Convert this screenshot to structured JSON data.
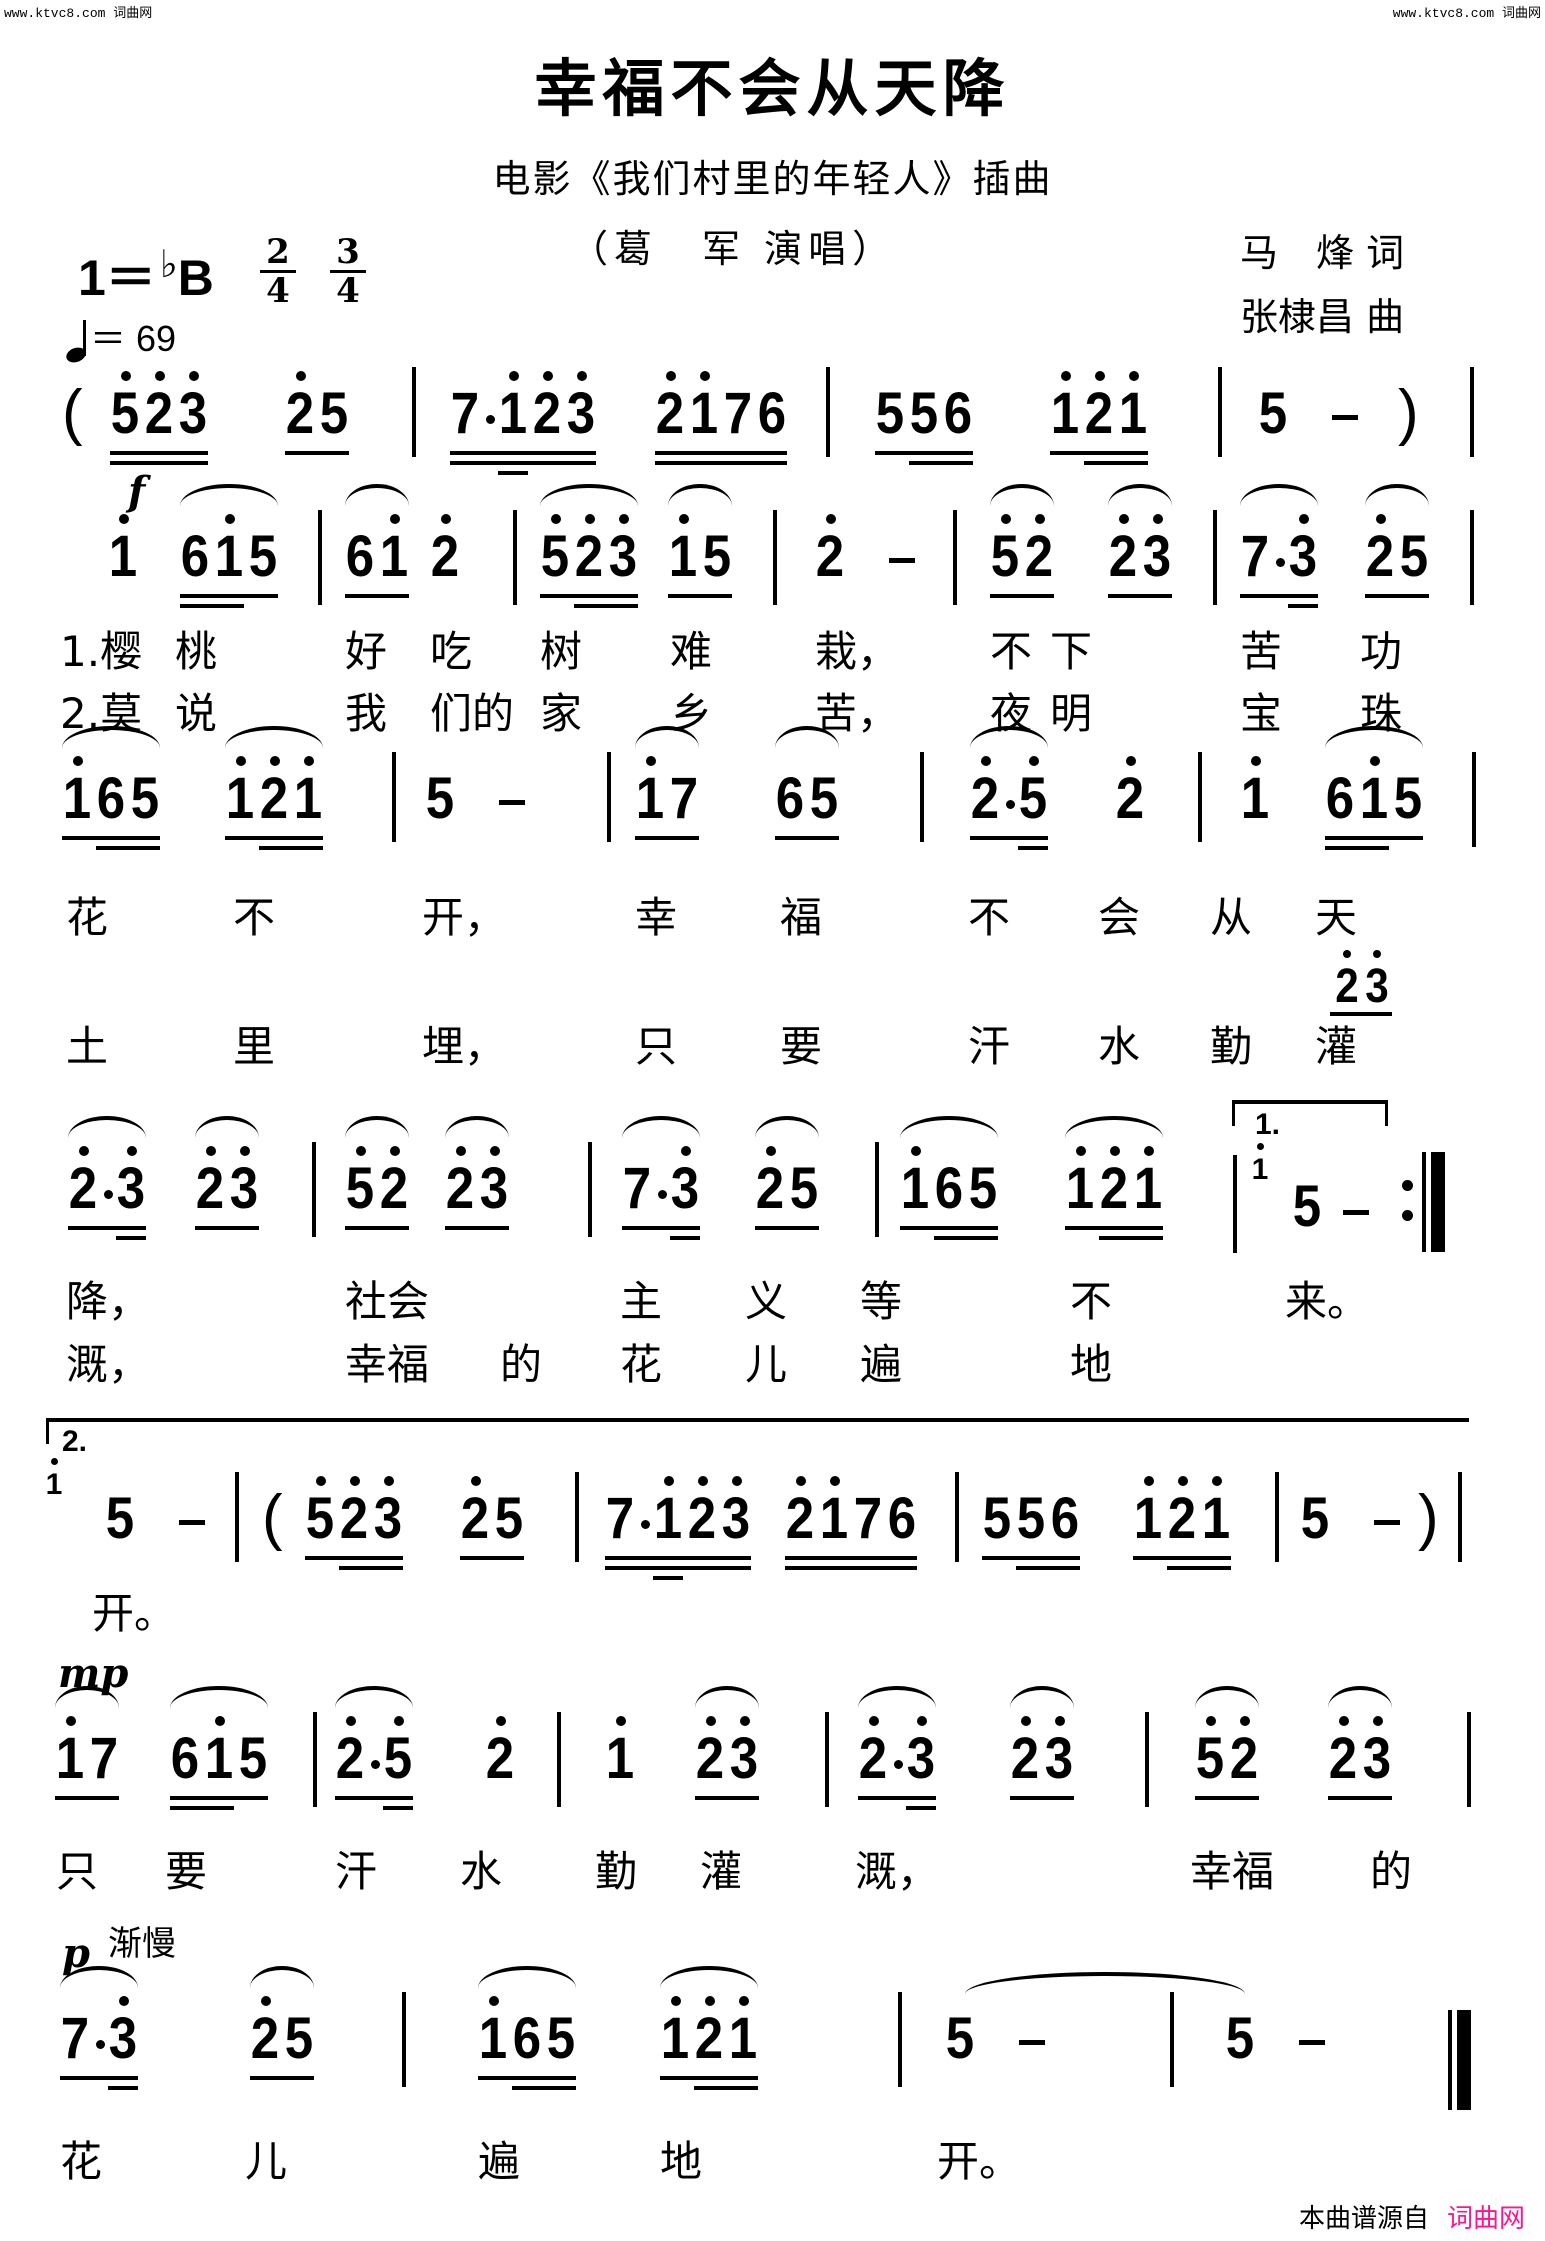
{
  "watermark": {
    "left": "www.ktvc8.com 词曲网",
    "right": "www.ktvc8.com 词曲网"
  },
  "header": {
    "title": "幸福不会从天降",
    "subtitle": "电影《我们村里的年轻人》插曲",
    "singer": "（葛　军 演唱）",
    "lyricist": "马　烽 词",
    "composer": "张棣昌 曲",
    "key": "1＝",
    "key_flat": "♭",
    "key_note": "B",
    "time_signatures": [
      {
        "num": "2",
        "den": "4"
      },
      {
        "num": "3",
        "den": "4"
      }
    ],
    "tempo_label": "＝ 69"
  },
  "dynamics": {
    "f": "f",
    "mp": "mp",
    "p": "p",
    "rit": "渐慢"
  },
  "voltas": {
    "first": "1.",
    "second": "2."
  },
  "score": [
    {
      "row": 1,
      "groups": [
        {
          "notes": [
            "5",
            "2",
            "3"
          ],
          "hi": [
            1,
            1,
            1
          ],
          "ul": 2,
          "ul2": [
            1,
            2
          ]
        },
        {
          "notes": [
            "2",
            "5"
          ],
          "hi": [
            1,
            0
          ],
          "ul": 1
        },
        {
          "bar": true
        },
        {
          "notes": [
            "7",
            "·",
            "1",
            "2",
            "3"
          ],
          "hi": [
            0,
            0,
            1,
            1,
            1
          ],
          "ul": 2,
          "ul3": [
            2,
            2
          ]
        },
        {
          "notes": [
            "2",
            "1",
            "7",
            "6"
          ],
          "hi": [
            1,
            1,
            0,
            0
          ],
          "ul": 2
        },
        {
          "bar": true
        },
        {
          "notes": [
            "5",
            "5",
            "6"
          ],
          "hi": [
            0,
            0,
            0
          ],
          "ul": 1,
          "ul2": [
            1,
            2
          ]
        },
        {
          "notes": [
            "1",
            "2",
            "1"
          ],
          "hi": [
            1,
            1,
            1
          ],
          "ul": 1,
          "ul2": [
            1,
            2
          ]
        },
        {
          "bar": true
        },
        {
          "notes": [
            "5",
            "–"
          ],
          "hi": [
            0,
            0
          ],
          "ul": 0
        }
      ]
    },
    {
      "row": 2,
      "groups": [
        {
          "notes": [
            "1"
          ],
          "hi": [
            1
          ]
        },
        {
          "notes": [
            "6",
            "1",
            "5"
          ],
          "hi": [
            0,
            1,
            0
          ],
          "ul": 1,
          "ul2": [
            0,
            1
          ]
        },
        {
          "bar": true
        },
        {
          "notes": [
            "6",
            "1"
          ],
          "hi": [
            0,
            1
          ],
          "ul": 1
        },
        {
          "notes": [
            "2"
          ],
          "hi": [
            1
          ]
        },
        {
          "bar": true
        },
        {
          "notes": [
            "5",
            "2",
            "3"
          ],
          "hi": [
            1,
            1,
            1
          ],
          "ul": 1,
          "ul2": [
            1,
            2
          ]
        },
        {
          "notes": [
            "1",
            "5"
          ],
          "hi": [
            1,
            0
          ],
          "ul": 1
        },
        {
          "bar": true
        },
        {
          "notes": [
            "2",
            "–"
          ],
          "hi": [
            1,
            0
          ]
        },
        {
          "bar": true
        },
        {
          "notes": [
            "5",
            "2"
          ],
          "hi": [
            1,
            1
          ],
          "ul": 1
        },
        {
          "notes": [
            "2",
            "3"
          ],
          "hi": [
            1,
            1
          ],
          "ul": 1
        },
        {
          "bar": true
        },
        {
          "notes": [
            "7",
            "·",
            "3"
          ],
          "hi": [
            0,
            0,
            1
          ],
          "ul": 1,
          "ul2": [
            2,
            2
          ]
        },
        {
          "notes": [
            "2",
            "5"
          ],
          "hi": [
            1,
            0
          ],
          "ul": 1
        }
      ]
    },
    {
      "row": 3,
      "groups": [
        {
          "notes": [
            "1",
            "6",
            "5"
          ],
          "hi": [
            1,
            0,
            0
          ],
          "ul": 1,
          "ul2": [
            1,
            2
          ]
        },
        {
          "notes": [
            "1",
            "2",
            "1"
          ],
          "hi": [
            1,
            1,
            1
          ],
          "ul": 1,
          "ul2": [
            1,
            2
          ]
        },
        {
          "bar": true
        },
        {
          "notes": [
            "5",
            "–"
          ],
          "hi": [
            0,
            0
          ]
        },
        {
          "bar": true
        },
        {
          "notes": [
            "1",
            "7"
          ],
          "hi": [
            1,
            0
          ],
          "ul": 1
        },
        {
          "notes": [
            "6",
            "5"
          ],
          "hi": [
            0,
            0
          ],
          "ul": 1
        },
        {
          "bar": true
        },
        {
          "notes": [
            "2",
            "·",
            "5"
          ],
          "hi": [
            1,
            0,
            1
          ],
          "ul": 1,
          "ul2": [
            2,
            2
          ]
        },
        {
          "notes": [
            "2"
          ],
          "hi": [
            1
          ]
        },
        {
          "bar": true
        },
        {
          "notes": [
            "1"
          ],
          "hi": [
            1
          ]
        },
        {
          "notes": [
            "6",
            "1",
            "5"
          ],
          "hi": [
            0,
            1,
            0
          ],
          "ul": 1,
          "ul2": [
            0,
            1
          ]
        }
      ]
    },
    {
      "row": 4,
      "groups": [
        {
          "notes": [
            "2",
            "·",
            "3"
          ],
          "hi": [
            1,
            0,
            1
          ],
          "ul": 1,
          "ul2": [
            2,
            2
          ]
        },
        {
          "notes": [
            "2",
            "3"
          ],
          "hi": [
            1,
            1
          ],
          "ul": 1
        },
        {
          "bar": true
        },
        {
          "notes": [
            "5",
            "2"
          ],
          "hi": [
            1,
            1
          ],
          "ul": 1
        },
        {
          "notes": [
            "2",
            "3"
          ],
          "hi": [
            1,
            1
          ],
          "ul": 1
        },
        {
          "bar": true
        },
        {
          "notes": [
            "7",
            "·",
            "3"
          ],
          "hi": [
            0,
            0,
            1
          ],
          "ul": 1,
          "ul2": [
            2,
            2
          ]
        },
        {
          "notes": [
            "2",
            "5"
          ],
          "hi": [
            1,
            0
          ],
          "ul": 1
        },
        {
          "bar": true
        },
        {
          "notes": [
            "1",
            "6",
            "5"
          ],
          "hi": [
            1,
            0,
            0
          ],
          "ul": 1,
          "ul2": [
            1,
            2
          ]
        },
        {
          "notes": [
            "1",
            "2",
            "1"
          ],
          "hi": [
            1,
            1,
            1
          ],
          "ul": 1,
          "ul2": [
            1,
            2
          ]
        }
      ]
    },
    {
      "row": 5,
      "groups": [
        {
          "notes": [
            "5",
            "–"
          ],
          "hi": [
            0,
            0
          ]
        },
        {
          "bar": true
        },
        {
          "notes": [
            "5",
            "2",
            "3"
          ],
          "hi": [
            1,
            1,
            1
          ],
          "ul": 1,
          "ul2": [
            1,
            2
          ]
        },
        {
          "notes": [
            "2",
            "5"
          ],
          "hi": [
            1,
            0
          ],
          "ul": 1
        },
        {
          "bar": true
        },
        {
          "notes": [
            "7",
            "·",
            "1",
            "2",
            "3"
          ],
          "hi": [
            0,
            0,
            1,
            1,
            1
          ],
          "ul": 2,
          "ul3": [
            2,
            2
          ]
        },
        {
          "notes": [
            "2",
            "1",
            "7",
            "6"
          ],
          "hi": [
            1,
            1,
            0,
            0
          ],
          "ul": 2
        },
        {
          "bar": true
        },
        {
          "notes": [
            "5",
            "5",
            "6"
          ],
          "hi": [
            0,
            0,
            0
          ],
          "ul": 1,
          "ul2": [
            1,
            2
          ]
        },
        {
          "notes": [
            "1",
            "2",
            "1"
          ],
          "hi": [
            1,
            1,
            1
          ],
          "ul": 1,
          "ul2": [
            1,
            2
          ]
        },
        {
          "bar": true
        },
        {
          "notes": [
            "5",
            "–"
          ],
          "hi": [
            0,
            0
          ]
        }
      ]
    },
    {
      "row": 6,
      "groups": [
        {
          "notes": [
            "1",
            "7"
          ],
          "hi": [
            1,
            0
          ],
          "ul": 1
        },
        {
          "notes": [
            "6",
            "1",
            "5"
          ],
          "hi": [
            0,
            1,
            0
          ],
          "ul": 1,
          "ul2": [
            0,
            1
          ]
        },
        {
          "bar": true
        },
        {
          "notes": [
            "2",
            "·",
            "5"
          ],
          "hi": [
            1,
            0,
            1
          ],
          "ul": 1,
          "ul2": [
            2,
            2
          ]
        },
        {
          "notes": [
            "2"
          ],
          "hi": [
            1
          ]
        },
        {
          "bar": true
        },
        {
          "notes": [
            "1"
          ],
          "hi": [
            1
          ]
        },
        {
          "notes": [
            "2",
            "3"
          ],
          "hi": [
            1,
            1
          ],
          "ul": 1
        },
        {
          "bar": true
        },
        {
          "notes": [
            "2",
            "·",
            "3"
          ],
          "hi": [
            1,
            0,
            1
          ],
          "ul": 1,
          "ul2": [
            2,
            2
          ]
        },
        {
          "notes": [
            "2",
            "3"
          ],
          "hi": [
            1,
            1
          ],
          "ul": 1
        },
        {
          "bar": true
        },
        {
          "notes": [
            "5",
            "2"
          ],
          "hi": [
            1,
            1
          ],
          "ul": 1
        },
        {
          "notes": [
            "2",
            "3"
          ],
          "hi": [
            1,
            1
          ],
          "ul": 1
        }
      ]
    },
    {
      "row": 7,
      "groups": [
        {
          "notes": [
            "7",
            "·",
            "3"
          ],
          "hi": [
            0,
            0,
            1
          ],
          "ul": 1,
          "ul2": [
            2,
            2
          ]
        },
        {
          "notes": [
            "2",
            "5"
          ],
          "hi": [
            1,
            0
          ],
          "ul": 1
        },
        {
          "bar": true
        },
        {
          "notes": [
            "1",
            "6",
            "5"
          ],
          "hi": [
            1,
            0,
            0
          ],
          "ul": 1,
          "ul2": [
            1,
            2
          ]
        },
        {
          "notes": [
            "1",
            "2",
            "1"
          ],
          "hi": [
            1,
            1,
            1
          ],
          "ul": 1,
          "ul2": [
            1,
            2
          ]
        },
        {
          "bar": true
        },
        {
          "notes": [
            "5",
            "–"
          ],
          "hi": [
            0,
            0
          ]
        },
        {
          "bar": true
        },
        {
          "notes": [
            "5",
            "–"
          ],
          "hi": [
            0,
            0
          ]
        }
      ]
    }
  ],
  "lyrics": {
    "row2_v1": [
      "1.樱",
      "桃",
      "好",
      "吃",
      "树",
      "难",
      "栽，",
      "不",
      "下",
      "苦",
      "功"
    ],
    "row2_v2": [
      "2.莫",
      "说",
      "我",
      "们的",
      "家",
      "乡",
      "苦，",
      "夜",
      "明",
      "宝",
      "珠"
    ],
    "row3_v1": [
      "花",
      "不",
      "开，",
      "幸",
      "福",
      "不",
      "会",
      "从",
      "天"
    ],
    "row3_v2": [
      "土",
      "里",
      "埋，",
      "只",
      "要",
      "汗",
      "水",
      "勤",
      "灌"
    ],
    "row3_v2_extra_notes": "23",
    "row4_v1": [
      "降，",
      "社会",
      "主",
      "义",
      "等",
      "不",
      "来。"
    ],
    "row4_v2": [
      "溉，",
      "幸福",
      "的",
      "花",
      "儿",
      "遍",
      "地"
    ],
    "row5": [
      "开。"
    ],
    "row6": [
      "只",
      "要",
      "汗",
      "水",
      "勤",
      "灌",
      "溉，",
      "幸福",
      "的"
    ],
    "row7": [
      "花",
      "儿",
      "遍",
      "地",
      "开。"
    ]
  },
  "footer": {
    "source": "本曲谱源自",
    "brand": "词曲网",
    "brand_color": "#ff1493"
  }
}
